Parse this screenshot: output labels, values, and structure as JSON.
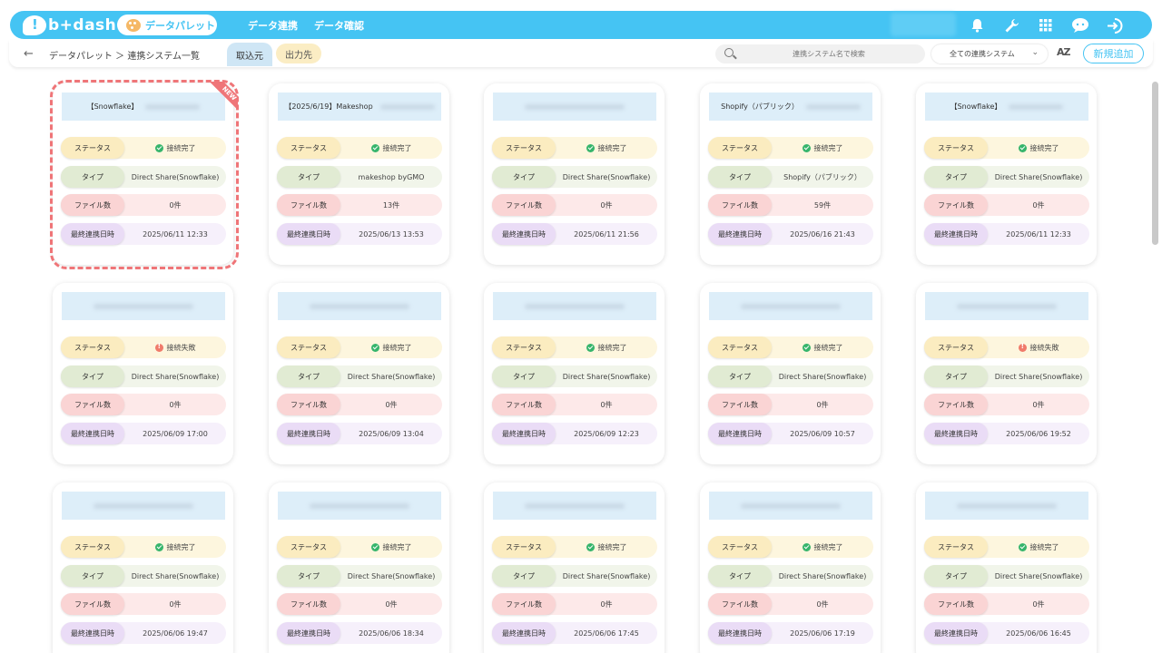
{
  "app": {
    "logo": "b+dash"
  },
  "nav": {
    "palette": "データパレット",
    "link1": "データ連携",
    "link2": "データ確認"
  },
  "subnav": {
    "breadcrumb": "データパレット ＞ 連携システム一覧",
    "tab_import": "取込元",
    "tab_export": "出力先",
    "search_placeholder": "連携システム名で検索",
    "filter_selected": "全ての連携システム",
    "sort_label": "AZ",
    "add_button": "新規追加"
  },
  "labels": {
    "status": "ステータス",
    "type": "タイプ",
    "files": "ファイル数",
    "last_sync": "最終連携日時"
  },
  "status_text": {
    "ok": "接続完了",
    "ng": "接続失敗"
  },
  "badge_new": "NEW",
  "colors": {
    "accent": "#45c4f3",
    "highlight": "#ef7578",
    "ok": "#36b56c",
    "ng": "#f07b6b"
  },
  "cards": [
    {
      "title": "【Snowflake】",
      "status": "ok",
      "type": "Direct Share(Snowflake)",
      "files": "0件",
      "date": "2025/06/11 12:33",
      "is_new": true
    },
    {
      "title": "【2025/6/19】Makeshop",
      "status": "ok",
      "type": "makeshop byGMO",
      "files": "13件",
      "date": "2025/06/13 13:53"
    },
    {
      "title": "",
      "status": "ok",
      "type": "Direct Share(Snowflake)",
      "files": "0件",
      "date": "2025/06/11 21:56"
    },
    {
      "title": "Shopify（パブリック）",
      "status": "ok",
      "type": "Shopify（パブリック）",
      "files": "59件",
      "date": "2025/06/16 21:43"
    },
    {
      "title": "【Snowflake】",
      "status": "ok",
      "type": "Direct Share(Snowflake)",
      "files": "0件",
      "date": "2025/06/11 12:33"
    },
    {
      "title": "",
      "status": "ng",
      "type": "Direct Share(Snowflake)",
      "files": "0件",
      "date": "2025/06/09 17:00"
    },
    {
      "title": "",
      "status": "ok",
      "type": "Direct Share(Snowflake)",
      "files": "0件",
      "date": "2025/06/09 13:04"
    },
    {
      "title": "",
      "status": "ok",
      "type": "Direct Share(Snowflake)",
      "files": "0件",
      "date": "2025/06/09 12:23"
    },
    {
      "title": "",
      "status": "ok",
      "type": "Direct Share(Snowflake)",
      "files": "0件",
      "date": "2025/06/09 10:57"
    },
    {
      "title": "",
      "status": "ng",
      "type": "Direct Share(Snowflake)",
      "files": "0件",
      "date": "2025/06/06 19:52"
    },
    {
      "title": "",
      "status": "ok",
      "type": "Direct Share(Snowflake)",
      "files": "0件",
      "date": "2025/06/06 19:47"
    },
    {
      "title": "",
      "status": "ok",
      "type": "Direct Share(Snowflake)",
      "files": "0件",
      "date": "2025/06/06 18:34"
    },
    {
      "title": "",
      "status": "ok",
      "type": "Direct Share(Snowflake)",
      "files": "0件",
      "date": "2025/06/06 17:45"
    },
    {
      "title": "",
      "status": "ok",
      "type": "Direct Share(Snowflake)",
      "files": "0件",
      "date": "2025/06/06 17:19"
    },
    {
      "title": "",
      "status": "ok",
      "type": "Direct Share(Snowflake)",
      "files": "0件",
      "date": "2025/06/06 16:45"
    }
  ]
}
